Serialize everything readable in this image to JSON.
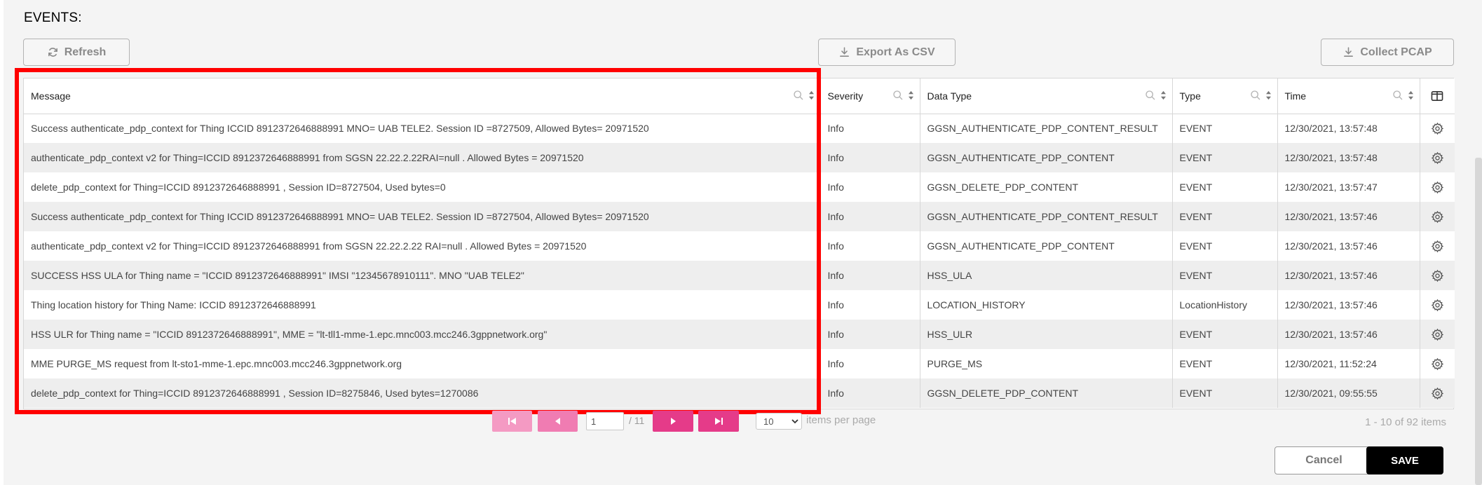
{
  "section": {
    "title": "EVENTS:"
  },
  "toolbar": {
    "refresh_label": "Refresh",
    "export_label": "Export As CSV",
    "pcap_label": "Collect PCAP"
  },
  "table": {
    "columns": [
      "Message",
      "Severity",
      "Data Type",
      "Type",
      "Time"
    ],
    "rows": [
      {
        "message": "Success authenticate_pdp_context for Thing ICCID  8912372646888991  MNO= UAB TELE2. Session ID =8727509, Allowed Bytes= 20971520",
        "severity": "Info",
        "data_type": "GGSN_AUTHENTICATE_PDP_CONTENT_RESULT",
        "type": "EVENT",
        "time": "12/30/2021, 13:57:48"
      },
      {
        "message": "authenticate_pdp_context v2 for Thing=ICCID  8912372646888991  from SGSN 22.22.2.22RAI=null . Allowed Bytes = 20971520",
        "severity": "Info",
        "data_type": "GGSN_AUTHENTICATE_PDP_CONTENT",
        "type": "EVENT",
        "time": "12/30/2021, 13:57:48"
      },
      {
        "message": "delete_pdp_context for Thing=ICCID  8912372646888991 , Session ID=8727504, Used bytes=0",
        "severity": "Info",
        "data_type": "GGSN_DELETE_PDP_CONTENT",
        "type": "EVENT",
        "time": "12/30/2021, 13:57:47"
      },
      {
        "message": "Success authenticate_pdp_context for Thing ICCID  8912372646888991  MNO= UAB TELE2. Session ID =8727504, Allowed Bytes= 20971520",
        "severity": "Info",
        "data_type": "GGSN_AUTHENTICATE_PDP_CONTENT_RESULT",
        "type": "EVENT",
        "time": "12/30/2021, 13:57:46"
      },
      {
        "message": "authenticate_pdp_context v2 for Thing=ICCID   8912372646888991  from SGSN 22.22.2.22 RAI=null . Allowed Bytes = 20971520",
        "severity": "Info",
        "data_type": "GGSN_AUTHENTICATE_PDP_CONTENT",
        "type": "EVENT",
        "time": "12/30/2021, 13:57:46"
      },
      {
        "message": "SUCCESS HSS ULA for Thing name = \"ICCID   8912372646888991\" IMSI \"12345678910111\". MNO \"UAB TELE2\"",
        "severity": "Info",
        "data_type": "HSS_ULA",
        "type": "EVENT",
        "time": "12/30/2021, 13:57:46"
      },
      {
        "message": "Thing location history for Thing Name: ICCID  8912372646888991",
        "severity": "Info",
        "data_type": "LOCATION_HISTORY",
        "type": "LocationHistory",
        "time": "12/30/2021, 13:57:46"
      },
      {
        "message": "HSS ULR for Thing name = \"ICCID   8912372646888991\", MME = \"lt-tll1-mme-1.epc.mnc003.mcc246.3gppnetwork.org\"",
        "severity": "Info",
        "data_type": "HSS_ULR",
        "type": "EVENT",
        "time": "12/30/2021, 13:57:46"
      },
      {
        "message": "MME PURGE_MS request from lt-sto1-mme-1.epc.mnc003.mcc246.3gppnetwork.org",
        "severity": "Info",
        "data_type": "PURGE_MS",
        "type": "EVENT",
        "time": "12/30/2021, 11:52:24"
      },
      {
        "message": "delete_pdp_context for Thing=ICCID   8912372646888991 , Session ID=8275846, Used bytes=1270086",
        "severity": "Info",
        "data_type": "GGSN_DELETE_PDP_CONTENT",
        "type": "EVENT",
        "time": "12/30/2021, 09:55:55"
      }
    ]
  },
  "pagination": {
    "page_value": "1",
    "total_pages": "/ 11",
    "per_page": "10",
    "per_page_label": "items per page",
    "summary": "1 - 10 of 92 items"
  },
  "footer": {
    "cancel_label": "Cancel",
    "save_label": "SAVE"
  },
  "colors": {
    "accent_pink": "#e53b89",
    "highlight": "#ff0000"
  },
  "icons": [
    "refresh-icon",
    "download-icon",
    "search-icon",
    "sort-icon",
    "columns-icon",
    "gear-icon",
    "first-page-icon",
    "prev-page-icon",
    "next-page-icon",
    "last-page-icon",
    "chevron-down-icon"
  ]
}
